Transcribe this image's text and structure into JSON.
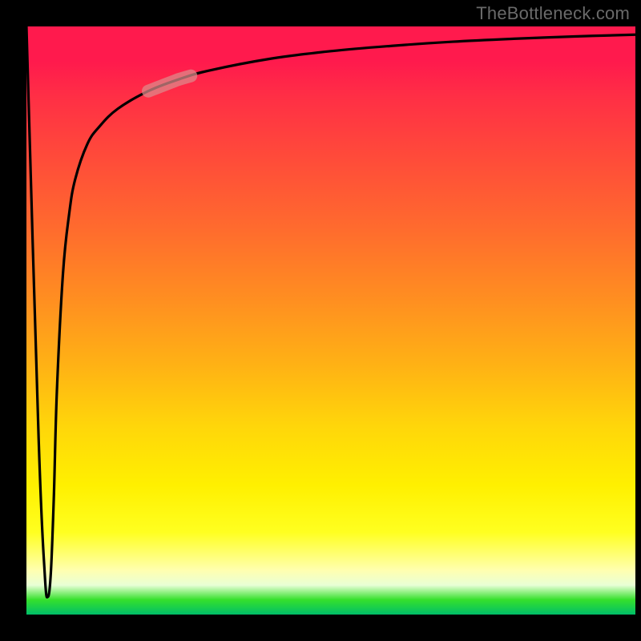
{
  "attribution": "TheBottleneck.com",
  "chart_data": {
    "type": "line",
    "title": "",
    "xlabel": "",
    "ylabel": "",
    "ylim": [
      0,
      100
    ],
    "xlim": [
      0,
      100
    ],
    "x": [
      0,
      2,
      3,
      3.5,
      4,
      4.5,
      5,
      6,
      7,
      8,
      10,
      12,
      15,
      20,
      25,
      30,
      40,
      50,
      60,
      70,
      80,
      90,
      100
    ],
    "values": [
      100,
      30,
      7,
      3,
      7,
      20,
      38,
      58,
      68,
      74,
      80,
      83,
      86,
      89,
      91,
      92.5,
      94.5,
      95.8,
      96.7,
      97.4,
      97.9,
      98.3,
      98.6
    ],
    "gradient": {
      "top": "#ff1a4d",
      "mid_upper": "#ff8d21",
      "mid": "#ffff20",
      "mid_lower": "#ffffb0",
      "bottom": "#00be69"
    },
    "highlight_range_x": [
      20,
      27
    ],
    "annotations": []
  }
}
